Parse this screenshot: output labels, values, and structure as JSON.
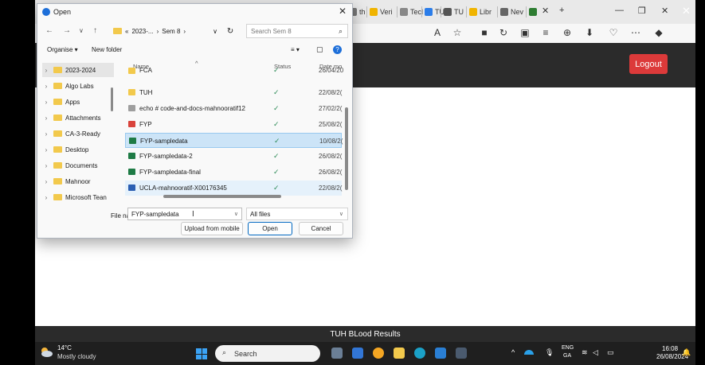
{
  "browser": {
    "tabs": [
      {
        "label": "th",
        "color": "#777777"
      },
      {
        "label": "Veri",
        "color": "#f0b400"
      },
      {
        "label": "Tecl",
        "color": "#888888"
      },
      {
        "label": "TU",
        "color": "#2b7de9"
      },
      {
        "label": "TU",
        "color": "#555555"
      },
      {
        "label": "Libr",
        "color": "#f0b400"
      },
      {
        "label": "Nev",
        "color": "#666666"
      },
      {
        "label": "",
        "color": "#2e7d32"
      }
    ],
    "new_tab_glyph": "+",
    "minimize_glyph": "—",
    "restore_glyph": "❐",
    "close_glyph": "✕",
    "toolbar_icons": [
      "A",
      "☆",
      "■",
      "↻",
      "▣",
      "≡",
      "⊕",
      "⬇",
      "♡",
      "⋯",
      "◆"
    ],
    "outer_close": "✕"
  },
  "page": {
    "logout_label": "Logout",
    "footer_text": "TUH BLood Results"
  },
  "dialog": {
    "title": "Open",
    "close": "✕",
    "nav": {
      "back": "←",
      "forward": "→",
      "down": "∨",
      "up": "↑"
    },
    "path_prefix": "«",
    "path": "2023-...",
    "path_sep1": "›",
    "path_current": "Sem 8",
    "path_sep2": "›",
    "path_dropdown": "∨",
    "refresh": "↻",
    "search_placeholder": "Search Sem 8",
    "search_icon": "⌕",
    "organise": "Organise ▾",
    "new_folder": "New folder",
    "view_icon": "≡ ▾",
    "pane_icon": "▢",
    "help_icon": "?",
    "nav_items": [
      {
        "label": "2023-2024",
        "selected": true
      },
      {
        "label": "Algo Labs"
      },
      {
        "label": "Apps"
      },
      {
        "label": "Attachments"
      },
      {
        "label": "CA-3-Ready"
      },
      {
        "label": "Desktop"
      },
      {
        "label": "Documents"
      },
      {
        "label": "Mahnoor"
      },
      {
        "label": "Microsoft Tean"
      }
    ],
    "columns": {
      "name": "Name",
      "status": "Status",
      "date": "Date mo",
      "sort_glyph": "^"
    },
    "files": [
      {
        "name": "FCA",
        "status": "✓",
        "date": "26/04/20",
        "type": "folder"
      },
      {
        "name": "TUH",
        "status": "✓",
        "date": "22/08/2(",
        "type": "folder"
      },
      {
        "name": "echo # code-and-docs-mahnooratif12",
        "status": "✓",
        "date": "27/02/2(",
        "type": "file"
      },
      {
        "name": "FYP",
        "status": "✓",
        "date": "25/08/2(",
        "type": "pdf"
      },
      {
        "name": "FYP-sampledata",
        "status": "✓",
        "date": "10/08/2(",
        "type": "excel",
        "selected": true
      },
      {
        "name": "FYP-sampledata-2",
        "status": "✓",
        "date": "26/08/2(",
        "type": "excel"
      },
      {
        "name": "FYP-sampledata-final",
        "status": "✓",
        "date": "26/08/2(",
        "type": "excel"
      },
      {
        "name": "UCLA-mahnooratif-X00176345",
        "status": "✓",
        "date": "22/08/2(",
        "type": "word",
        "hover": true
      }
    ],
    "file_name_label": "File name:",
    "file_name_value": "FYP-sampledata",
    "file_type": "All files",
    "dropdown_glyph": "∨",
    "upload_label": "Upload from mobile",
    "open_label": "Open",
    "cancel_label": "Cancel"
  },
  "taskbar": {
    "temp": "14°C",
    "weather": "Mostly cloudy",
    "search_placeholder": "Search",
    "search_icon": "⌕",
    "tray_caret": "^",
    "lang_top": "ENG",
    "lang_bottom": "GA",
    "time": "16:08",
    "date": "26/08/2024"
  }
}
